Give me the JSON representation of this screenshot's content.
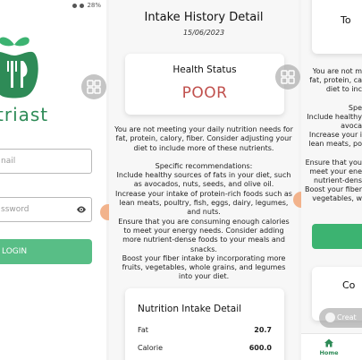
{
  "left_screen": {
    "status_text": "28%",
    "brand_name": "triast",
    "email_placeholder": "nail",
    "password_placeholder": "ssword",
    "login_label": "LOGIN"
  },
  "center_screen": {
    "title": "Intake History Detail",
    "date": "15/06/2023",
    "health_status_label": "Health Status",
    "health_status_value": "POOR",
    "summary": "You are not meeting your daily nutrition needs for fat, protein, calory, fiber. Consider adjusting your diet to include more of these nutrients.",
    "recommendations_heading": "Specific recommendations:",
    "recommendations": [
      "Include healthy sources of fats in your diet, such as avocados, nuts, seeds, and olive oil.",
      "Increase your intake of protein-rich foods such as lean meats, poultry, fish, eggs, dairy, legumes, and nuts.",
      "Ensure that you are consuming enough calories to meet your energy needs. Consider adding more nutrient-dense foods to your meals and snacks.",
      "Boost your fiber intake by incorporating more fruits, vegetables, whole grains, and legumes into your diet."
    ],
    "nutrition_title": "Nutrition Intake Detail",
    "nutrition_rows": [
      {
        "label": "Fat",
        "value": "20.7"
      },
      {
        "label": "Calorie",
        "value": "600.0"
      }
    ]
  },
  "right_screen": {
    "top_card_label": "To",
    "text_lines_1": [
      "You are not m",
      "fat, protein, ca",
      "diet to inc"
    ],
    "text_lines_2": [
      "Spe",
      "Include healthy",
      "avoca",
      "Increase your i",
      "lean meats, po"
    ],
    "text_lines_3": [
      "Ensure that you",
      "meet your ene",
      "nutrient-dens",
      "Boost your fiber",
      "vegetables, w"
    ],
    "bottom_card_label": "Co",
    "create_label": "Creat",
    "home_label": "Home"
  },
  "colors": {
    "brand_green": "#2e8b57",
    "button_green": "#3cb371",
    "poor_red": "#c0504d"
  }
}
